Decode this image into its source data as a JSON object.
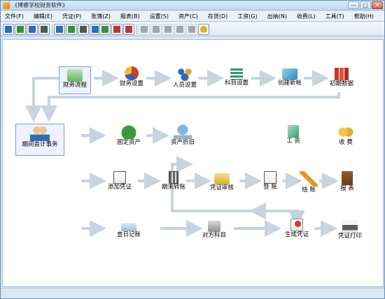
{
  "window": {
    "title": "《博睿学校财务软件》",
    "minimize_glyph": "—",
    "maximize_glyph": "□",
    "close_glyph": "✕"
  },
  "menu": [
    {
      "label": "文件(F)"
    },
    {
      "label": "编辑(E)"
    },
    {
      "label": "凭证(P)"
    },
    {
      "label": "账簿(Z)"
    },
    {
      "label": "报表(B)"
    },
    {
      "label": "设置(S)"
    },
    {
      "label": "资产(C)"
    },
    {
      "label": "存货(D)"
    },
    {
      "label": "工资(G)"
    },
    {
      "label": "出纳(N)"
    },
    {
      "label": "收费(L)"
    },
    {
      "label": "工具(T)"
    },
    {
      "label": "帮助(H)"
    }
  ],
  "toolbar": [
    {
      "icon": "voucher-entry-icon",
      "color": "#2f6db5"
    },
    {
      "icon": "voucher-review-icon",
      "color": "#3a8f3a"
    },
    {
      "icon": "voucher-post-icon",
      "color": "#2f6db5"
    },
    {
      "icon": "ledger-icon",
      "color": "#555555"
    },
    {
      "icon": "report-icon",
      "color": "#2f6db5"
    },
    {
      "icon": "account-set-icon",
      "color": "#3a8f3a"
    },
    {
      "icon": "user-icon",
      "color": "#555555"
    },
    {
      "icon": "calculator-icon",
      "color": "#2f6db5"
    },
    {
      "icon": "table-icon",
      "color": "#3a8f3a"
    },
    {
      "icon": "chart-icon",
      "color": "#3a8f3a"
    },
    {
      "icon": "tools-icon",
      "color": "#b23b3b"
    },
    {
      "icon": "print-icon",
      "color": "#b23b3b"
    },
    {
      "icon": "save-icon",
      "color": "#9aa7b5"
    },
    {
      "icon": "pen-icon",
      "color": "#9aa7b5"
    },
    {
      "icon": "cut-icon",
      "color": "#9aa7b5"
    },
    {
      "icon": "copy-icon",
      "color": "#9aa7b5"
    },
    {
      "icon": "paste-icon",
      "color": "#9aa7b5"
    },
    {
      "icon": "help-bulb-icon",
      "color": "#d9b420"
    }
  ],
  "flow": {
    "row1": [
      {
        "label": "财务流程",
        "icon": "flowchart-icon"
      },
      {
        "label": "财务设置",
        "icon": "pie-chart-icon"
      },
      {
        "label": "人员设置",
        "icon": "people-icon"
      },
      {
        "label": "科目设置",
        "icon": "account-list-icon"
      },
      {
        "label": "创建新帐",
        "icon": "new-ledger-icon"
      },
      {
        "label": "初期数据",
        "icon": "initial-data-icon"
      }
    ],
    "center": {
      "label": "期间会计事务",
      "icon": "accountants-icon"
    },
    "row2": [
      {
        "label": "固定资产",
        "icon": "fixed-asset-icon"
      },
      {
        "label": "资产折旧",
        "icon": "depreciation-icon"
      },
      {
        "label": "工  资",
        "icon": "salary-icon"
      },
      {
        "label": "收  费",
        "icon": "fees-icon"
      }
    ],
    "row3": [
      {
        "label": "添加凭证",
        "icon": "add-voucher-icon"
      },
      {
        "label": "期末转账",
        "icon": "calculator-icon"
      },
      {
        "label": "凭证审核",
        "icon": "folder-icon"
      },
      {
        "label": "登  账",
        "icon": "post-ledger-icon"
      },
      {
        "label": "结  账",
        "icon": "close-books-icon"
      },
      {
        "label": "报  表",
        "icon": "report-book-icon"
      }
    ],
    "row4": [
      {
        "label": "查日记账",
        "icon": "journal-icon"
      },
      {
        "label": "对方科目",
        "icon": "counter-account-icon"
      },
      {
        "label": "生成凭证",
        "icon": "generate-voucher-icon"
      },
      {
        "label": "凭证打印",
        "icon": "printer-icon"
      }
    ]
  },
  "colors": {
    "arrow": "#c9d3de",
    "accent": "#2f6db5"
  }
}
